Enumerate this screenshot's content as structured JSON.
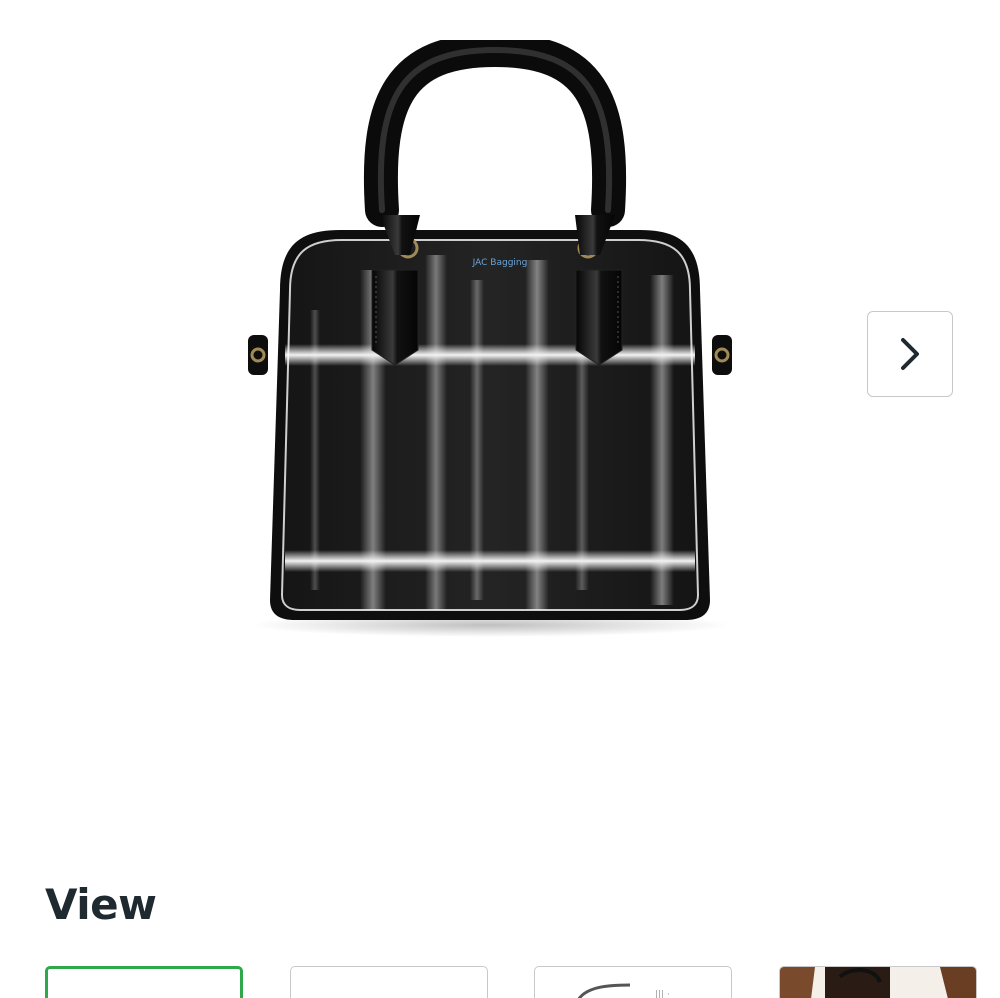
{
  "product": {
    "image_label": "handbag-product-photo",
    "brand_text": "JAC Bagging"
  },
  "carousel": {
    "next_icon": "chevron-right-icon"
  },
  "view_section": {
    "title": "View",
    "selected_index": 0,
    "thumbnails": [
      {
        "name": "thumbnail-front"
      },
      {
        "name": "thumbnail-side"
      },
      {
        "name": "thumbnail-back"
      },
      {
        "name": "thumbnail-model"
      }
    ]
  },
  "colors": {
    "selected_border": "#2ea84a",
    "title_text": "#1f2a30"
  }
}
